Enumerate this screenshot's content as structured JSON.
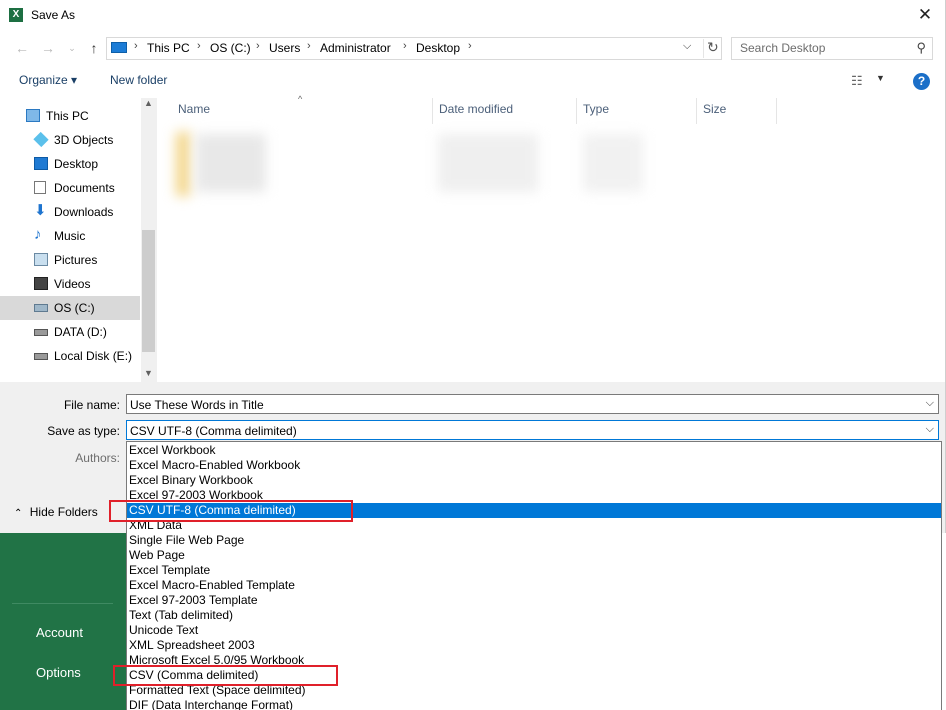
{
  "window": {
    "title": "Save As",
    "app_icon": "excel-icon"
  },
  "address": {
    "crumbs": [
      "This PC",
      "OS (C:)",
      "Users",
      "Administrator",
      "Desktop"
    ],
    "search_placeholder": "Search Desktop"
  },
  "toolbar": {
    "organize_label": "Organize ▾",
    "new_folder_label": "New folder"
  },
  "nav": {
    "items": [
      {
        "label": "This PC",
        "icon": "computer-icon"
      },
      {
        "label": "3D Objects",
        "icon": "cube-icon"
      },
      {
        "label": "Desktop",
        "icon": "desktop-icon"
      },
      {
        "label": "Documents",
        "icon": "document-icon"
      },
      {
        "label": "Downloads",
        "icon": "download-icon"
      },
      {
        "label": "Music",
        "icon": "music-icon"
      },
      {
        "label": "Pictures",
        "icon": "pictures-icon"
      },
      {
        "label": "Videos",
        "icon": "video-icon"
      },
      {
        "label": "OS (C:)",
        "icon": "drive-icon"
      },
      {
        "label": "DATA (D:)",
        "icon": "drive-icon"
      },
      {
        "label": "Local Disk (E:)",
        "icon": "drive-icon"
      }
    ],
    "selected": "OS (C:)"
  },
  "filelist": {
    "columns": [
      "Name",
      "Date modified",
      "Type",
      "Size"
    ]
  },
  "form": {
    "file_name_label": "File name:",
    "file_name_value": "Use These Words in Title",
    "save_type_label": "Save as type:",
    "save_type_value": "CSV UTF-8 (Comma delimited)",
    "authors_label": "Authors:",
    "hide_folders_label": "Hide Folders"
  },
  "save_type_options": [
    "Excel Workbook",
    "Excel Macro-Enabled Workbook",
    "Excel Binary Workbook",
    "Excel 97-2003 Workbook",
    "CSV UTF-8 (Comma delimited)",
    "XML Data",
    "Single File Web Page",
    "Web Page",
    "Excel Template",
    "Excel Macro-Enabled Template",
    "Excel 97-2003 Template",
    "Text (Tab delimited)",
    "Unicode Text",
    "XML Spreadsheet 2003",
    "Microsoft Excel 5.0/95 Workbook",
    "CSV (Comma delimited)",
    "Formatted Text (Space delimited)",
    "DIF (Data Interchange Format)"
  ],
  "selected_option": "CSV UTF-8 (Comma delimited)",
  "backstage": {
    "account_label": "Account",
    "options_label": "Options"
  },
  "colors": {
    "accent": "#0078d7",
    "excel_green": "#217346",
    "highlight_red": "#e0202a"
  }
}
